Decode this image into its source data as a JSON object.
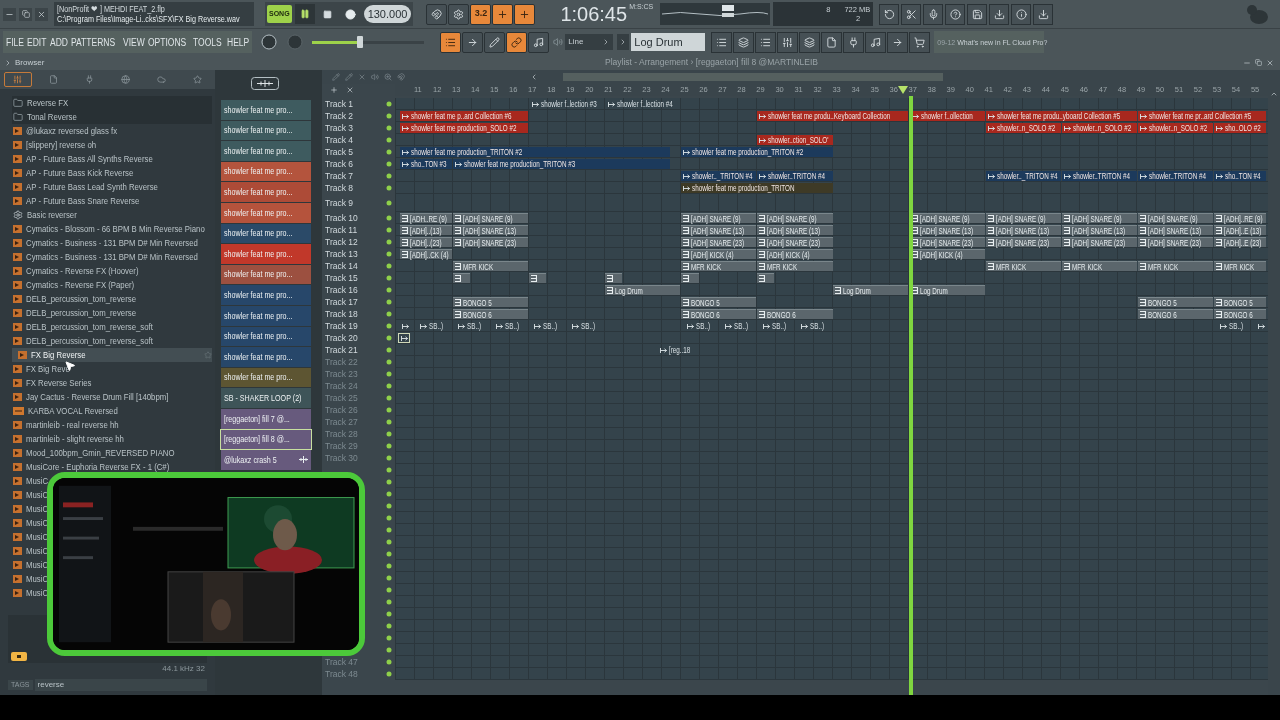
{
  "window": {
    "title": "[NonProfit ❤ ] MEHDI FEAT_2.flp",
    "path": "C:\\Program Files\\Image-Li..cks\\SFX\\FX Big Reverse.wav"
  },
  "transport": {
    "song_mode": {
      "label": "SONG",
      "selected": true
    },
    "tempo": "130.000",
    "time": "1:06:45",
    "time_format": "M:S:CS"
  },
  "monitor": {
    "cpu": "8",
    "memory": "722 MB",
    "polyphony": "2"
  },
  "toggles_top": [
    {
      "on": false
    },
    {
      "on": false
    },
    {
      "label": "3.2",
      "on": true
    },
    {
      "on": true
    },
    {
      "on": true
    }
  ],
  "menu": [
    "FILE",
    "EDIT",
    "ADD",
    "PATTERNS",
    "VIEW",
    "OPTIONS",
    "TOOLS",
    "HELP"
  ],
  "master": {
    "level": 0.43
  },
  "toggles_bottom": [
    {
      "on": true
    },
    {
      "on": false
    },
    {
      "on": false
    },
    {
      "on": true
    },
    {
      "on": false
    }
  ],
  "snap": "Line",
  "pattern": "Log Drum",
  "news": {
    "date": "09-12",
    "text": "What's new in FL Cloud Pro?"
  },
  "browser": {
    "title": "Browser",
    "tabs": [
      {
        "selected": true
      },
      {
        "selected": false
      },
      {
        "selected": false
      },
      {
        "selected": false
      },
      {
        "selected": false
      },
      {
        "selected": false
      }
    ],
    "items": [
      {
        "label": "Reverse FX",
        "kind": "folder",
        "selected": false
      },
      {
        "label": "Tonal Reverse",
        "kind": "folder",
        "selected": false
      },
      {
        "label": "@lukaxz reversed glass fx",
        "kind": "audio",
        "selected": false
      },
      {
        "label": "[slippery] reverse oh",
        "kind": "audio",
        "selected": false
      },
      {
        "label": "AP - Future Bass All Synths Reverse",
        "kind": "audio",
        "selected": false
      },
      {
        "label": "AP - Future Bass Kick Reverse",
        "kind": "audio",
        "selected": false
      },
      {
        "label": "AP - Future Bass Lead Synth Reverse",
        "kind": "audio",
        "selected": false
      },
      {
        "label": "AP - Future Bass Snare Reverse",
        "kind": "audio",
        "selected": false
      },
      {
        "label": "Basic reverser",
        "kind": "plugin",
        "selected": false
      },
      {
        "label": "Cymatics - Blossom - 66 BPM B Min Reverse Piano",
        "kind": "audio",
        "selected": false
      },
      {
        "label": "Cymatics - Business - 131 BPM D# Min Reversed",
        "kind": "audio",
        "selected": false
      },
      {
        "label": "Cymatics - Business - 131 BPM D# Min Reversed",
        "kind": "audio",
        "selected": false
      },
      {
        "label": "Cymatics - Reverse FX (Hoover)",
        "kind": "audio",
        "selected": false
      },
      {
        "label": "Cymatics - Reverse FX (Paper)",
        "kind": "audio",
        "selected": false
      },
      {
        "label": "DELB_percussion_tom_reverse",
        "kind": "audio",
        "selected": false
      },
      {
        "label": "DELB_percussion_tom_reverse",
        "kind": "audio",
        "selected": false
      },
      {
        "label": "DELB_percussion_tom_reverse_soft",
        "kind": "audio",
        "selected": false
      },
      {
        "label": "DELB_percussion_tom_reverse_soft",
        "kind": "audio",
        "selected": false
      },
      {
        "label": "FX Big Reverse",
        "kind": "audio",
        "selected": true
      },
      {
        "label": "FX Big Reve",
        "kind": "audio",
        "selected": false
      },
      {
        "label": "FX Reverse Series",
        "kind": "audio",
        "selected": false
      },
      {
        "label": "Jay Cactus - Reverse Drum Fill [140bpm]",
        "kind": "audio",
        "selected": false
      },
      {
        "label": "KARBA VOCAL Reversed",
        "kind": "loop",
        "selected": false
      },
      {
        "label": "martinleib - real reverse hh",
        "kind": "audio",
        "selected": false
      },
      {
        "label": "martinleib - slight reverse hh",
        "kind": "audio",
        "selected": false
      },
      {
        "label": "Mood_100bpm_Gmin_REVERSED PIANO",
        "kind": "audio",
        "selected": false
      },
      {
        "label": "MusiCore - Euphoria Reverse FX - 1 (C#)",
        "kind": "audio",
        "selected": false
      },
      {
        "label": "MusiC",
        "kind": "audio",
        "selected": false
      },
      {
        "label": "MusiC",
        "kind": "audio",
        "selected": false
      },
      {
        "label": "MusiC",
        "kind": "audio",
        "selected": false
      },
      {
        "label": "MusiC",
        "kind": "audio",
        "selected": false
      },
      {
        "label": "MusiC",
        "kind": "audio",
        "selected": false
      },
      {
        "label": "MusiC",
        "kind": "audio",
        "selected": false
      },
      {
        "label": "MusiC",
        "kind": "audio",
        "selected": false
      },
      {
        "label": "MusiC",
        "kind": "audio",
        "selected": false
      },
      {
        "label": "MusiC",
        "kind": "audio",
        "selected": false
      }
    ],
    "sample_info": "44.1 kHz 32",
    "tags_label": "TAGS",
    "tags_value": "reverse"
  },
  "channels": [
    {
      "label": "showler feat me pro...",
      "color": "#3e5b5f",
      "selected": false
    },
    {
      "label": "showler feat me pro...",
      "color": "#3e5b5f",
      "selected": false
    },
    {
      "label": "showler feat me pro...",
      "color": "#3e5b5f",
      "selected": false
    },
    {
      "label": "showler feat me pro...",
      "color": "#b4543d",
      "selected": false
    },
    {
      "label": "showler feat me pro...",
      "color": "#ad4b37",
      "selected": false
    },
    {
      "label": "showler feat me pro...",
      "color": "#b5533c",
      "selected": false
    },
    {
      "label": "showler feat me pro...",
      "color": "#2b4a68",
      "selected": false
    },
    {
      "label": "showler feat me pro...",
      "color": "#c1382a",
      "selected": false
    },
    {
      "label": "showler feat me pro...",
      "color": "#9c5040",
      "selected": false
    },
    {
      "label": "showler feat me pro...",
      "color": "#27476a",
      "selected": false
    },
    {
      "label": "showler feat me pro...",
      "color": "#27476a",
      "selected": false
    },
    {
      "label": "showler feat me pro...",
      "color": "#27476a",
      "selected": false
    },
    {
      "label": "showler feat me pro...",
      "color": "#27476a",
      "selected": false
    },
    {
      "label": "showler feat me pro...",
      "color": "#5d5532",
      "selected": false
    },
    {
      "label": "SB - SHAKER LOOP (2)",
      "color": "#3e5458",
      "selected": false
    },
    {
      "label": "[reggaeton] fill 7 @...",
      "color": "#675a7d",
      "selected": false
    },
    {
      "label": "[reggaeton] fill 8 @...",
      "color": "#675a7d",
      "selected": true
    },
    {
      "label": "@lukaxz crash 5",
      "color": "#675a7d",
      "selected": false
    }
  ],
  "playlist": {
    "title": "Playlist - Arrangement › [reggaeton] fill 8 @MARTINLEIB",
    "ruler": [
      "11",
      "12",
      "13",
      "14",
      "15",
      "16",
      "17",
      "18",
      "19",
      "20",
      "21",
      "22",
      "23",
      "24",
      "25",
      "26",
      "27",
      "28",
      "29",
      "30",
      "31",
      "32",
      "33",
      "34",
      "35",
      "36",
      "37",
      "38",
      "39",
      "40",
      "41",
      "42",
      "43",
      "44",
      "45",
      "46",
      "47",
      "48",
      "49",
      "50",
      "51",
      "52",
      "53",
      "54",
      "55"
    ],
    "tracks": [
      {
        "name": "Track 1",
        "dimmed": false,
        "clips": [
          {
            "label": "showler f..lection #3",
            "kind": "bare"
          },
          {
            "label": "showler f..lection #4",
            "kind": "bare"
          }
        ]
      },
      {
        "name": "Track 2",
        "dimmed": false,
        "clips": [
          {
            "label": "showler feat me p..ard Collection #6",
            "kind": "audio",
            "color": "#a8281e"
          },
          {
            "label": "showler feat me produ..Keyboard Collection",
            "kind": "audio",
            "color": "#a8281e"
          },
          {
            "label": "showler f..ollection",
            "kind": "audio",
            "color": "#a8281e"
          },
          {
            "label": "showler feat me produ..yboard Collection #5",
            "kind": "audio",
            "color": "#a8281e"
          },
          {
            "label": "showler feat me pr..ard Collection #5",
            "kind": "audio",
            "color": "#a8281e"
          }
        ]
      },
      {
        "name": "Track 3",
        "dimmed": false,
        "clips": [
          {
            "label": "showler feat me production_SOLO #2",
            "kind": "audio",
            "color": "#a8281e"
          },
          {
            "label": "showler..n_SOLO #2",
            "kind": "audio",
            "color": "#a8281e"
          },
          {
            "label": "showler..n_SOLO #2",
            "kind": "audio",
            "color": "#a8281e"
          },
          {
            "label": "showler..n_SOLO #2",
            "kind": "audio",
            "color": "#a8281e"
          },
          {
            "label": "sho..OLO #2",
            "kind": "audio",
            "color": "#a8281e"
          }
        ]
      },
      {
        "name": "Track 4",
        "dimmed": false,
        "clips": [
          {
            "label": "showler..ction_SOLO'",
            "kind": "audio",
            "color": "#a8281e"
          }
        ]
      },
      {
        "name": "Track 5",
        "dimmed": false,
        "clips": [
          {
            "label": "showler feat me production_TRITON #2",
            "kind": "audio",
            "color": "#1c3a5c"
          },
          {
            "label": "showler feat me production_TRITON #2",
            "kind": "audio",
            "color": "#1c3a5c"
          }
        ]
      },
      {
        "name": "Track 6",
        "dimmed": false,
        "clips": [
          {
            "label": "sho..TON #3",
            "kind": "audio",
            "color": "#1c3a5c"
          },
          {
            "label": "showler feat me production_TRITON #3",
            "kind": "audio",
            "color": "#1c3a5c"
          }
        ]
      },
      {
        "name": "Track 7",
        "dimmed": false,
        "clips": [
          {
            "label": "showler.._TRITON #4",
            "kind": "audio",
            "color": "#1c3a5c"
          },
          {
            "label": "showler..TRITON #4",
            "kind": "audio",
            "color": "#1c3a5c"
          },
          {
            "label": "showler.._TRITON #4",
            "kind": "audio",
            "color": "#1c3a5c"
          },
          {
            "label": "showler..TRITON #4",
            "kind": "audio",
            "color": "#1c3a5c"
          },
          {
            "label": "showler..TRITON #4",
            "kind": "audio",
            "color": "#1c3a5c"
          },
          {
            "label": "sho..TON #4",
            "kind": "audio",
            "color": "#1c3a5c"
          }
        ]
      },
      {
        "name": "Track 8",
        "dimmed": false,
        "clips": [
          {
            "label": "showler feat me production_TRITON",
            "kind": "audio",
            "color": "#3e3a26"
          }
        ]
      },
      {
        "name": "Track 9",
        "dimmed": false
      },
      {
        "name": "Track 10",
        "dimmed": false,
        "clips": [
          {
            "label": "[ADH..RE (9)",
            "kind": "pattern"
          },
          {
            "label": "[ADH] SNARE (9)",
            "kind": "pattern"
          },
          {
            "label": "[ADH] SNARE (9)",
            "kind": "pattern"
          },
          {
            "label": "[ADH] SNARE (9)",
            "kind": "pattern"
          },
          {
            "label": "[ADH] SNARE (9)",
            "kind": "pattern"
          },
          {
            "label": "[ADH] SNARE (9)",
            "kind": "pattern"
          },
          {
            "label": "[ADH] SNARE (9)",
            "kind": "pattern"
          },
          {
            "label": "[ADH] SNARE (9)",
            "kind": "pattern"
          },
          {
            "label": "[ADH]..RE (9)",
            "kind": "pattern"
          }
        ]
      },
      {
        "name": "Track 11",
        "dimmed": false,
        "clips": [
          {
            "label": "[ADH]..(13)",
            "kind": "pattern"
          },
          {
            "label": "[ADH] SNARE (13)",
            "kind": "pattern"
          },
          {
            "label": "[ADH] SNARE (13)",
            "kind": "pattern"
          },
          {
            "label": "[ADH] SNARE (13)",
            "kind": "pattern"
          },
          {
            "label": "[ADH] SNARE (13)",
            "kind": "pattern"
          },
          {
            "label": "[ADH] SNARE (13)",
            "kind": "pattern"
          },
          {
            "label": "[ADH] SNARE (13)",
            "kind": "pattern"
          },
          {
            "label": "[ADH] SNARE (13)",
            "kind": "pattern"
          },
          {
            "label": "[ADH]..E (13)",
            "kind": "pattern"
          }
        ]
      },
      {
        "name": "Track 12",
        "dimmed": false,
        "clips": [
          {
            "label": "[ADH]..(23)",
            "kind": "pattern"
          },
          {
            "label": "[ADH] SNARE (23)",
            "kind": "pattern"
          },
          {
            "label": "[ADH] SNARE (23)",
            "kind": "pattern"
          },
          {
            "label": "[ADH] SNARE (23)",
            "kind": "pattern"
          },
          {
            "label": "[ADH] SNARE (23)",
            "kind": "pattern"
          },
          {
            "label": "[ADH] SNARE (23)",
            "kind": "pattern"
          },
          {
            "label": "[ADH] SNARE (23)",
            "kind": "pattern"
          },
          {
            "label": "[ADH] SNARE (23)",
            "kind": "pattern"
          },
          {
            "label": "[ADH]..E (23)",
            "kind": "pattern"
          }
        ]
      },
      {
        "name": "Track 13",
        "dimmed": false,
        "clips": [
          {
            "label": "[ADH]..CK (4)",
            "kind": "pattern"
          },
          {
            "label": "[ADH] KICK (4)",
            "kind": "pattern"
          },
          {
            "label": "[ADH] KICK (4)",
            "kind": "pattern"
          },
          {
            "label": "[ADH] KICK (4)",
            "kind": "pattern"
          }
        ]
      },
      {
        "name": "Track 14",
        "dimmed": false,
        "clips": [
          {
            "label": "MFR KICK",
            "kind": "pattern"
          },
          {
            "label": "MFR KICK",
            "kind": "pattern"
          },
          {
            "label": "MFR KICK",
            "kind": "pattern"
          },
          {
            "label": "MFR KICK",
            "kind": "pattern"
          },
          {
            "label": "MFR KICK",
            "kind": "pattern"
          },
          {
            "label": "MFR KICK",
            "kind": "pattern"
          },
          {
            "label": "MFR KICK",
            "kind": "pattern"
          }
        ]
      },
      {
        "name": "Track 15",
        "dimmed": false,
        "clips": [
          {
            "kind": "pattern"
          },
          {
            "kind": "pattern"
          },
          {
            "kind": "pattern"
          },
          {
            "kind": "pattern"
          },
          {
            "kind": "pattern"
          }
        ]
      },
      {
        "name": "Track 16",
        "dimmed": false,
        "clips": [
          {
            "label": "Log Drum",
            "kind": "pattern"
          },
          {
            "label": "Log Drum",
            "kind": "pattern"
          },
          {
            "label": "Log Drum",
            "kind": "pattern"
          }
        ]
      },
      {
        "name": "Track 17",
        "dimmed": false,
        "clips": [
          {
            "label": "BONGO 5",
            "kind": "pattern"
          },
          {
            "label": "BONGO 5",
            "kind": "pattern"
          },
          {
            "label": "BONGO 5",
            "kind": "pattern"
          },
          {
            "label": "BONGO 5",
            "kind": "pattern"
          }
        ]
      },
      {
        "name": "Track 18",
        "dimmed": false,
        "clips": [
          {
            "label": "BONGO 6",
            "kind": "pattern"
          },
          {
            "label": "BONGO 6",
            "kind": "pattern"
          },
          {
            "label": "BONGO 6",
            "kind": "pattern"
          },
          {
            "label": "BONGO 6",
            "kind": "pattern"
          },
          {
            "label": "BONGO 6",
            "kind": "pattern"
          }
        ]
      },
      {
        "name": "Track 19",
        "dimmed": false,
        "clips": [
          {
            "kind": "bare"
          },
          {
            "label": "SB..)",
            "kind": "bare"
          },
          {
            "label": "SB..)",
            "kind": "bare"
          },
          {
            "label": "SB..)",
            "kind": "bare"
          },
          {
            "label": "SB..)",
            "kind": "bare"
          },
          {
            "label": "SB..)",
            "kind": "bare"
          },
          {
            "label": "SB..)",
            "kind": "bare"
          },
          {
            "label": "SB..)",
            "kind": "bare"
          },
          {
            "label": "SB..)",
            "kind": "bare"
          },
          {
            "label": "SB..)",
            "kind": "bare"
          },
          {
            "label": "SB..)",
            "kind": "bare"
          },
          {
            "kind": "bare"
          }
        ]
      },
      {
        "name": "Track 20",
        "dimmed": false,
        "clips": [
          {
            "kind": "bare"
          }
        ]
      },
      {
        "name": "Track 21",
        "dimmed": false,
        "clips": [
          {
            "label": "[reg..18",
            "kind": "bare"
          }
        ]
      },
      {
        "name": "Track 22",
        "dimmed": true
      },
      {
        "name": "Track 23",
        "dimmed": true
      },
      {
        "name": "Track 24",
        "dimmed": true
      },
      {
        "name": "Track 25",
        "dimmed": true
      },
      {
        "name": "Track 26",
        "dimmed": true
      },
      {
        "name": "Track 27",
        "dimmed": true
      },
      {
        "name": "Track 28",
        "dimmed": true
      },
      {
        "name": "Track 29",
        "dimmed": true
      },
      {
        "name": "Track 30",
        "dimmed": true
      },
      {
        "name": "Track 47",
        "dimmed": true
      },
      {
        "name": "Track 48",
        "dimmed": true
      }
    ]
  },
  "overlay": {
    "kind": "picture"
  }
}
